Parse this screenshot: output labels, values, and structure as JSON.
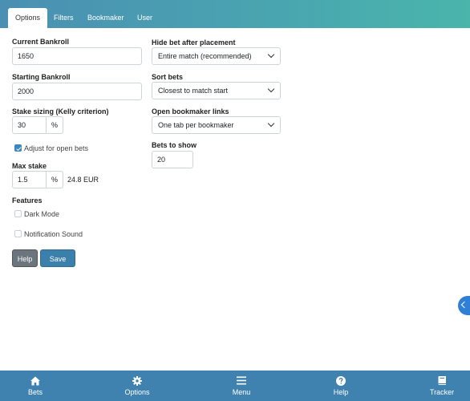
{
  "tabs": [
    "Options",
    "Filters",
    "Bookmaker",
    "User"
  ],
  "left": {
    "current_bankroll": {
      "label": "Current Bankroll",
      "value": "1650"
    },
    "starting_bankroll": {
      "label": "Starting Bankroll",
      "value": "2000"
    },
    "stake_sizing": {
      "label": "Stake sizing (Kelly criterion)",
      "value": "30",
      "unit": "%"
    },
    "adjust_open_bets": {
      "label": "Adjust for open bets",
      "checked": true
    },
    "max_stake": {
      "label": "Max stake",
      "value": "1.5",
      "unit": "%",
      "note": "24.8 EUR"
    },
    "features": {
      "label": "Features",
      "dark_mode": {
        "label": "Dark Mode",
        "checked": false
      },
      "notification_sound": {
        "label": "Notification Sound",
        "checked": false
      }
    },
    "buttons": {
      "help": "Help",
      "save": "Save"
    }
  },
  "right": {
    "hide_bet": {
      "label": "Hide bet after placement",
      "value": "Entire match (recommended)"
    },
    "sort_bets": {
      "label": "Sort bets",
      "value": "Closest to match start"
    },
    "open_links": {
      "label": "Open bookmaker links",
      "value": "One tab per bookmaker"
    },
    "bets_to_show": {
      "label": "Bets to show",
      "value": "20"
    }
  },
  "bottom_nav": [
    {
      "label": "Bets",
      "icon": "home-icon"
    },
    {
      "label": "Options",
      "icon": "gear-icon"
    },
    {
      "label": "Menu",
      "icon": "menu-icon"
    },
    {
      "label": "Help",
      "icon": "question-icon"
    },
    {
      "label": "Tracker",
      "icon": "book-icon"
    }
  ],
  "colors": {
    "accent": "#3f82b0",
    "tab_gradient_end": "#4ab5ab",
    "checkbox": "#3b87c4",
    "help_button": "#6c757d"
  }
}
